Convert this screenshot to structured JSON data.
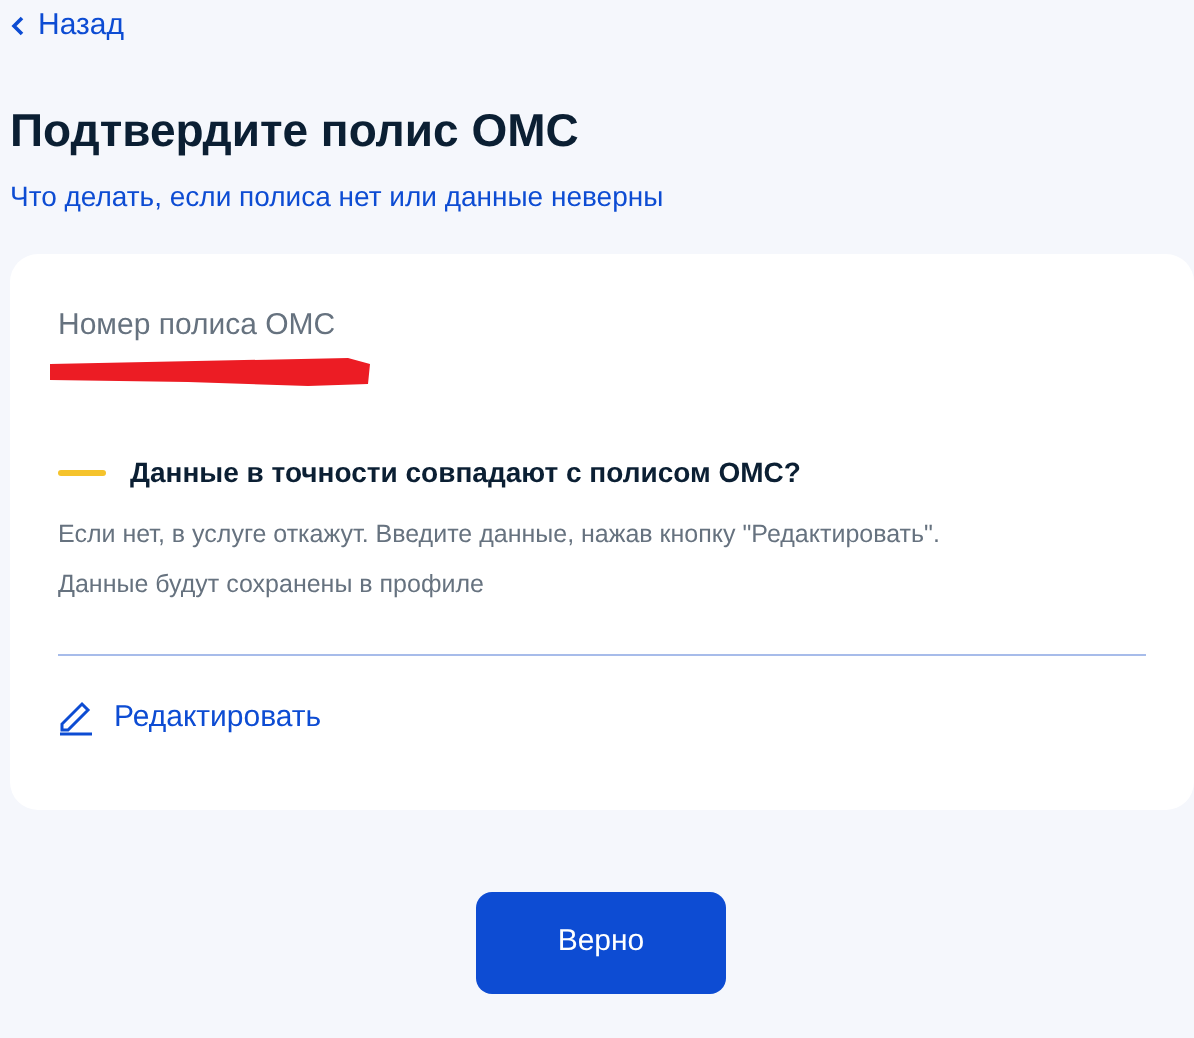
{
  "back_link": {
    "label": "Назад"
  },
  "title": "Подтвердите полис ОМС",
  "help_link": "Что делать, если полиса нет или данные неверны",
  "card": {
    "field_label": "Номер полиса ОМС",
    "value_redacted": true,
    "warning": {
      "title": "Данные в точности совпадают с полисом ОМС?",
      "color": "#f5c32c",
      "text": "Если нет, в услуге откажут. Введите данные, нажав кнопку \"Редактировать\". Данные будут сохранены в профиле"
    },
    "edit_link": "Редактировать"
  },
  "confirm_button": "Верно"
}
